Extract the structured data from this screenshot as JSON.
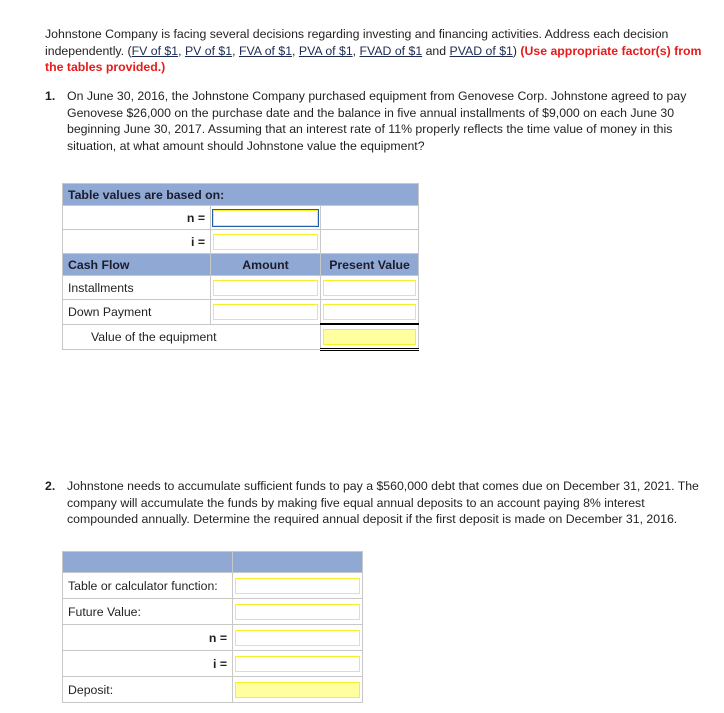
{
  "intro": {
    "text_part1": "Johnstone Company is facing several decisions regarding investing and financing activities. Address each decision independently. (",
    "links": [
      "FV of $1",
      "PV of $1",
      "FVA of $1",
      "PVA of $1",
      "FVAD of $1",
      "PVAD of $1"
    ],
    "sep_comma": ", ",
    "sep_and": " and ",
    "close_paren": ") ",
    "red_note": "(Use appropriate factor(s) from the tables provided.)"
  },
  "questions": [
    {
      "number": "1.",
      "text": "On June 30, 2016, the Johnstone Company purchased equipment from Genovese Corp. Johnstone agreed to pay Genovese $26,000 on the purchase date and the balance in five annual installments of $9,000 on each June 30 beginning June 30, 2017. Assuming that an interest rate of 11% properly reflects the time value of money in this situation, at what amount should Johnstone value the equipment?"
    },
    {
      "number": "2.",
      "text": "Johnstone needs to accumulate sufficient funds to pay a $560,000 debt that comes due on December 31, 2021. The company will accumulate the funds by making five equal annual deposits to an account paying 8% interest compounded annually. Determine the required annual deposit if the first deposit is made on December 31, 2016."
    }
  ],
  "table1": {
    "title": "Table values are based on:",
    "n_label": "n =",
    "n_value": "",
    "i_label": "i =",
    "i_value": "",
    "col_headers": {
      "cash_flow": "Cash Flow",
      "amount": "Amount",
      "present_value": "Present Value"
    },
    "rows": [
      {
        "label": "Installments",
        "amount": "",
        "present_value": ""
      },
      {
        "label": "Down Payment",
        "amount": "",
        "present_value": ""
      }
    ],
    "total_label": "Value of the equipment",
    "total_value": ""
  },
  "table2": {
    "header_left": "",
    "header_right": "",
    "rows": [
      {
        "label": "Table or calculator function:",
        "value": "",
        "style": "input"
      },
      {
        "label": "Future Value:",
        "value": "",
        "style": "input"
      },
      {
        "label": "n =",
        "value": "",
        "style": "input-right"
      },
      {
        "label": "i =",
        "value": "",
        "style": "input-right"
      },
      {
        "label": "Deposit:",
        "value": "",
        "style": "input-yellow"
      }
    ]
  },
  "colors": {
    "header_blue": "#8fa8d4",
    "input_yellow_border": "#f5f02a",
    "input_yellow_fill": "#ffffa0",
    "link": "#1d2b53",
    "red": "#e81a1a",
    "grid_line": "#c8c8c8"
  }
}
